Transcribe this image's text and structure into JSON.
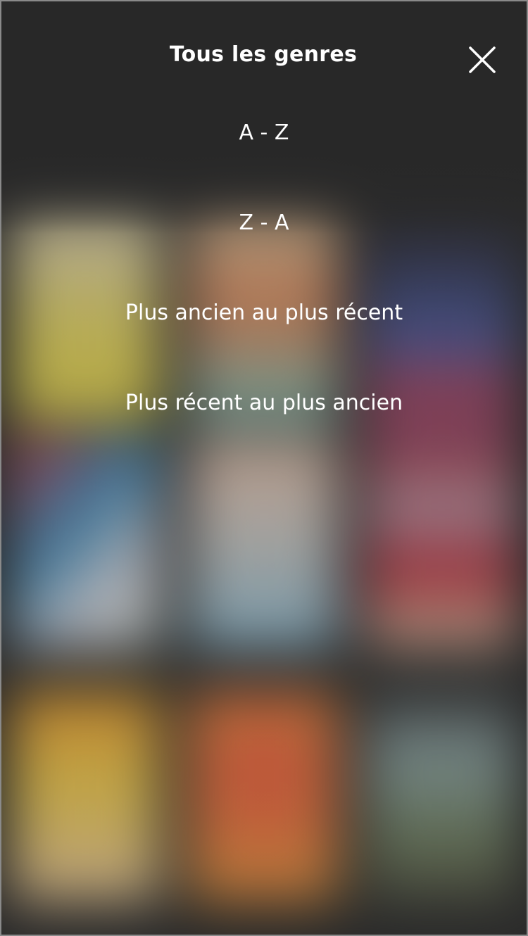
{
  "header": {
    "title": "Tous les genres",
    "close_icon": "close-icon"
  },
  "sort_options": [
    {
      "label": "A - Z"
    },
    {
      "label": "Z - A"
    },
    {
      "label": "Plus ancien au plus récent"
    },
    {
      "label": "Plus récent au plus ancien"
    }
  ],
  "colors": {
    "overlay": "#2b2b2b",
    "text": "#ffffff",
    "poster_colors": [
      "#f0d850",
      "#e8a070",
      "#5060a0",
      "#d05060",
      "#c8c8d0",
      "#c03040",
      "#f4c040",
      "#f06030",
      "#708070"
    ]
  }
}
